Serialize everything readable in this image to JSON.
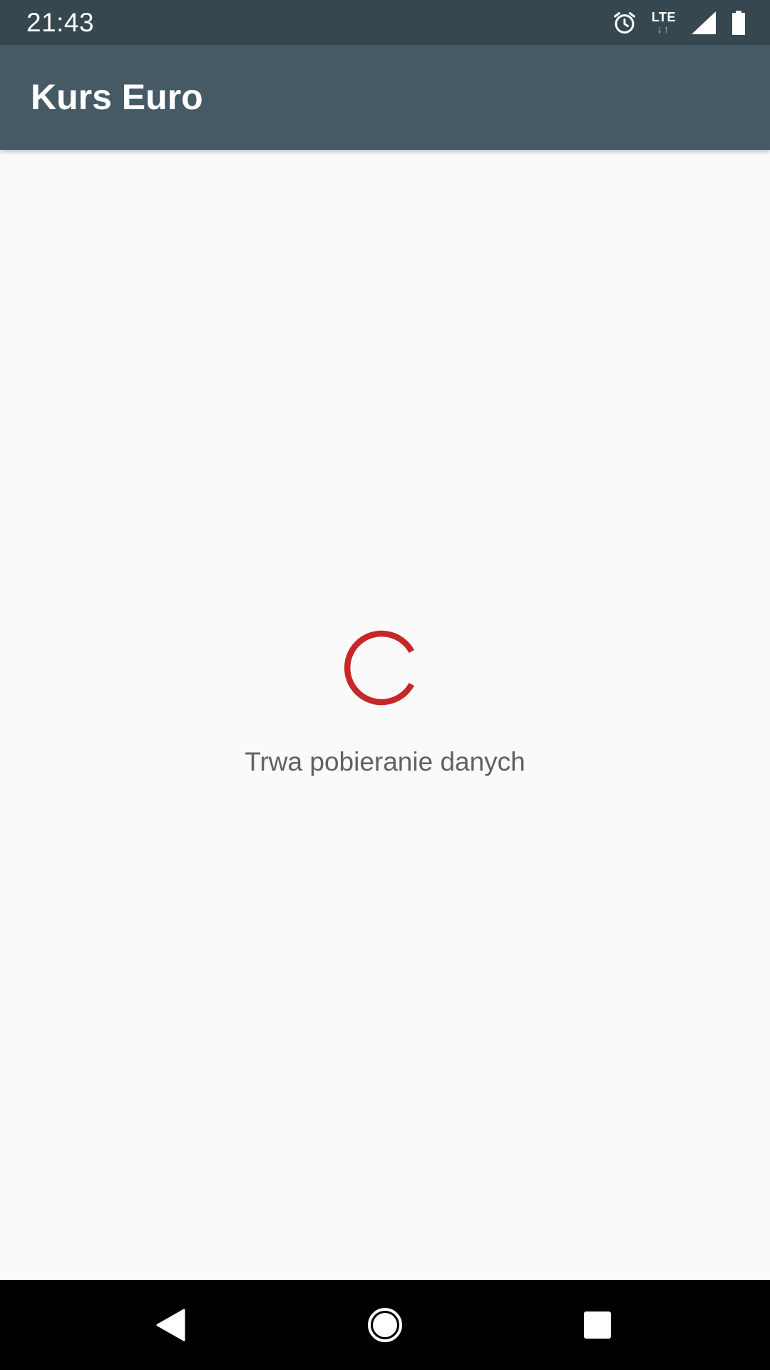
{
  "status_bar": {
    "time": "21:43",
    "network": "LTE",
    "network_arrows": "↓↑",
    "icons": [
      "alarm-icon",
      "lte-icon",
      "signal-icon",
      "battery-icon"
    ]
  },
  "app_bar": {
    "title": "Kurs Euro",
    "background": "#455a64"
  },
  "content": {
    "loading_text": "Trwa pobieranie danych",
    "spinner_color": "#c62828"
  },
  "nav_bar": {
    "buttons": [
      "back-icon",
      "home-icon",
      "recents-icon"
    ]
  }
}
